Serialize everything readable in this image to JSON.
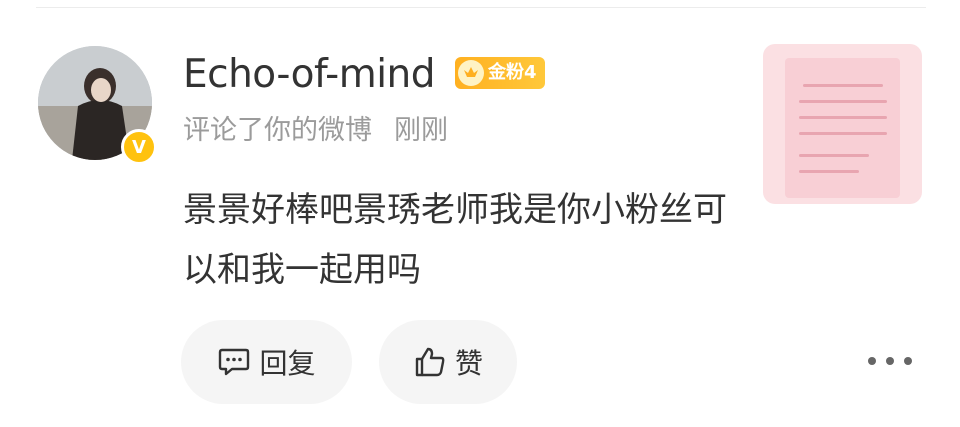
{
  "comment_card": {
    "username": "Echo-of-mind",
    "verified_mark": "V",
    "fan_badge": {
      "text": "金粉4",
      "color": "#ffb020",
      "icon": "crown-icon"
    },
    "action_text": "评论了你的微博",
    "timestamp": "刚刚",
    "body": "景景好棒吧景琇老师我是你小粉丝可以和我一起用吗",
    "actions": {
      "reply_label": "回复",
      "like_label": "赞"
    }
  },
  "icons": {
    "reply": "comment-bubble-icon",
    "like": "thumbs-up-icon",
    "more": "more-dots-icon"
  }
}
